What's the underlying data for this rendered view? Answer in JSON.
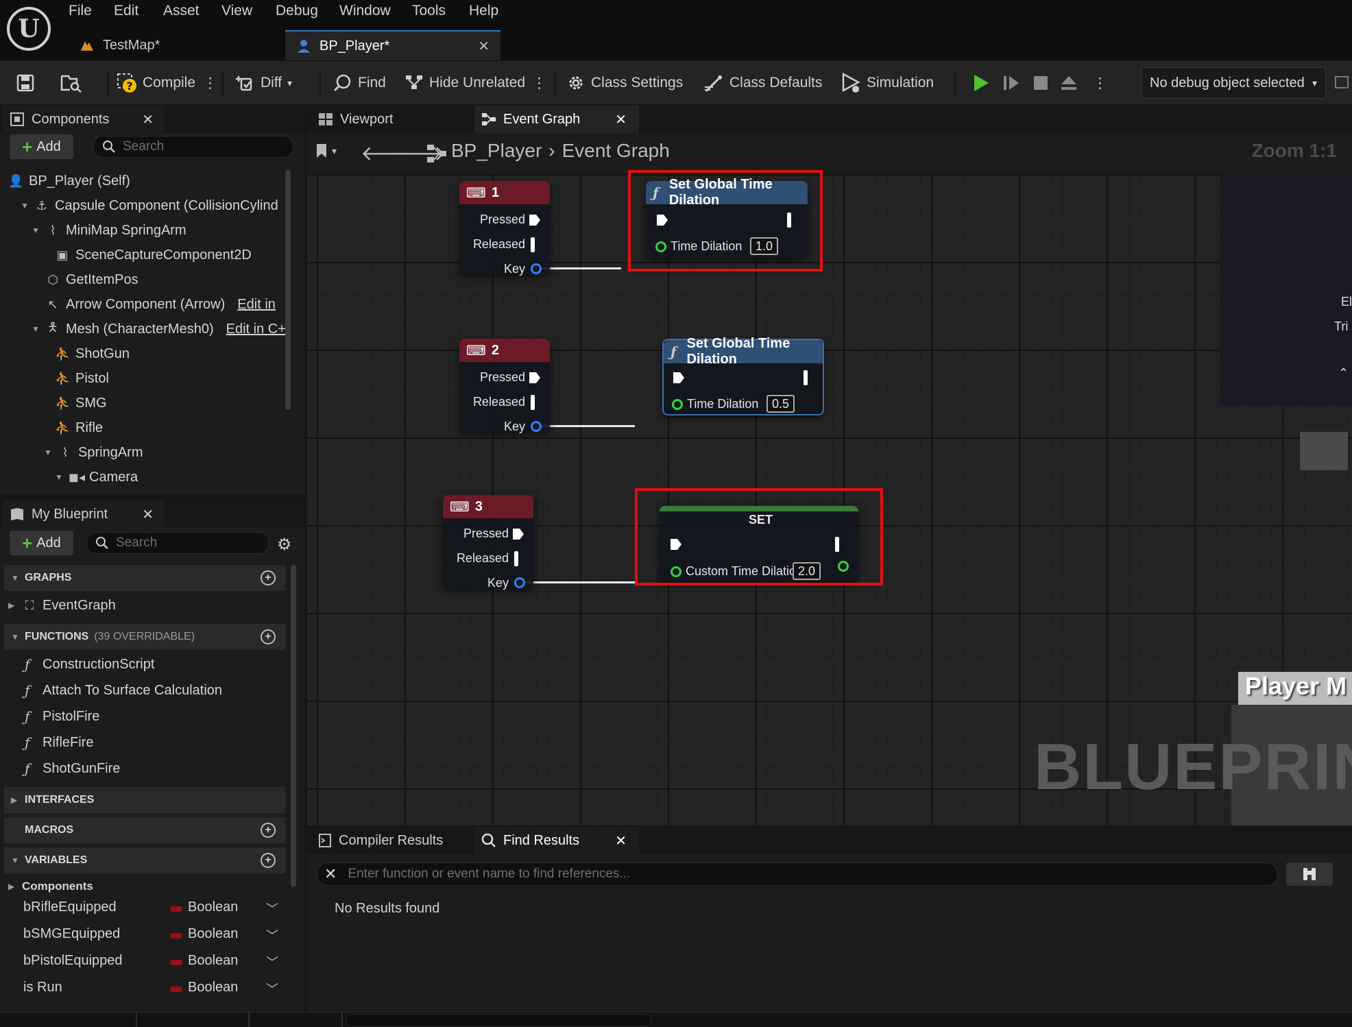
{
  "menu": {
    "items": [
      "File",
      "Edit",
      "Asset",
      "View",
      "Debug",
      "Window",
      "Tools",
      "Help"
    ]
  },
  "tabs": {
    "testmap": "TestMap*",
    "bp_player": "BP_Player*"
  },
  "toolbar": {
    "compile": "Compile",
    "diff": "Diff",
    "find": "Find",
    "hide_unrelated": "Hide Unrelated",
    "class_settings": "Class Settings",
    "class_defaults": "Class Defaults",
    "simulation": "Simulation",
    "debug_object": "No debug object selected"
  },
  "components": {
    "tab_label": "Components",
    "add_label": "Add",
    "search_placeholder": "Search",
    "items": [
      {
        "label": "BP_Player (Self)",
        "edit": ""
      },
      {
        "label": "Capsule Component (CollisionCylind",
        "edit": ""
      },
      {
        "label": "MiniMap SpringArm",
        "edit": ""
      },
      {
        "label": "SceneCaptureComponent2D",
        "edit": ""
      },
      {
        "label": "GetItemPos",
        "edit": ""
      },
      {
        "label": "Arrow Component (Arrow)",
        "edit": "Edit in"
      },
      {
        "label": "Mesh (CharacterMesh0)",
        "edit": "Edit in C+"
      },
      {
        "label": "ShotGun",
        "edit": ""
      },
      {
        "label": "Pistol",
        "edit": ""
      },
      {
        "label": "SMG",
        "edit": ""
      },
      {
        "label": "Rifle",
        "edit": ""
      },
      {
        "label": "SpringArm",
        "edit": ""
      },
      {
        "label": "Camera",
        "edit": ""
      }
    ]
  },
  "my_blueprint": {
    "tab_label": "My Blueprint",
    "add_label": "Add",
    "search_placeholder": "Search",
    "graphs_header": "GRAPHS",
    "graphs": [
      "EventGraph"
    ],
    "functions_header": "FUNCTIONS",
    "functions_count": "(39 OVERRIDABLE)",
    "functions": [
      "ConstructionScript",
      "Attach To Surface Calculation",
      "PistolFire",
      "RifleFire",
      "ShotGunFire"
    ],
    "interfaces_header": "INTERFACES",
    "macros_header": "MACROS",
    "variables_header": "VARIABLES",
    "variables_group": "Components",
    "variables": [
      {
        "name": "bRifleEquipped",
        "type": "Boolean"
      },
      {
        "name": "bSMGEquipped",
        "type": "Boolean"
      },
      {
        "name": "bPistolEquipped",
        "type": "Boolean"
      },
      {
        "name": "is Run",
        "type": "Boolean"
      }
    ]
  },
  "graph": {
    "viewport_tab": "Viewport",
    "event_graph_tab": "Event Graph",
    "breadcrumb_root": "BP_Player",
    "breadcrumb_current": "Event Graph",
    "zoom": "Zoom 1:1",
    "watermark": "BLUEPRINT",
    "side_node_fragment_1": "El",
    "side_node_fragment_2": "Tri",
    "player_fragment": "Player M",
    "key_nodes": [
      {
        "title": "1",
        "pressed": "Pressed",
        "released": "Released",
        "key": "Key"
      },
      {
        "title": "2",
        "pressed": "Pressed",
        "released": "Released",
        "key": "Key"
      },
      {
        "title": "3",
        "pressed": "Pressed",
        "released": "Released",
        "key": "Key"
      }
    ],
    "func_nodes": [
      {
        "title": "Set Global Time Dilation",
        "param": "Time Dilation",
        "value": "1.0"
      },
      {
        "title": "Set Global Time Dilation",
        "param": "Time Dilation",
        "value": "0.5"
      }
    ],
    "set_node": {
      "title": "SET",
      "param": "Custom Time Dilation",
      "value": "2.0"
    },
    "colors": {
      "key_header": "#6b1a26",
      "func_header": "#2f4f73",
      "set_header": "#3a7a3a",
      "highlight": "#e01010",
      "exec_wire": "#e8e8e8"
    }
  },
  "results": {
    "compiler_tab": "Compiler Results",
    "find_tab": "Find Results",
    "find_placeholder": "Enter function or event name to find references...",
    "no_results": "No Results found"
  }
}
